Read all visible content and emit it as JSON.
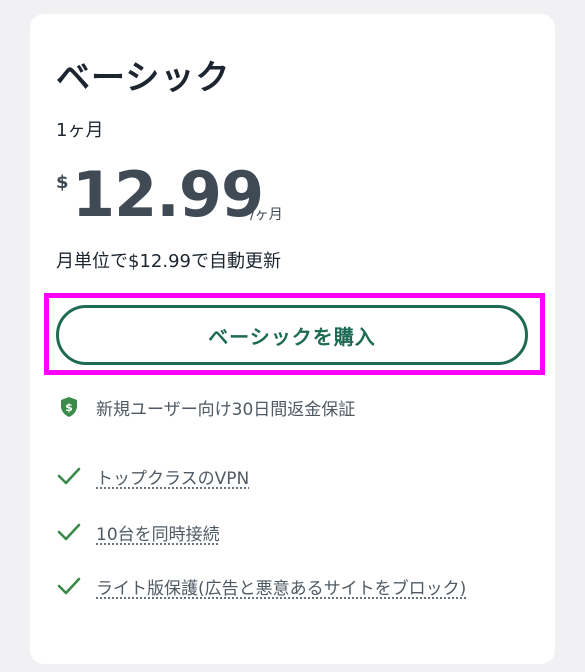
{
  "plan": {
    "title": "ベーシック",
    "period": "1ヶ月",
    "currency_symbol": "$",
    "price": "12.99",
    "price_unit": "/ヶ月",
    "renewal_note": "月単位で$12.99で自動更新"
  },
  "buy_button": {
    "label": "ベーシックを購入"
  },
  "features": [
    {
      "icon": "shield-dollar-icon",
      "text": "新規ユーザー向け30日間返金保証"
    },
    {
      "icon": "checkmark-icon",
      "text": "トップクラスのVPN"
    },
    {
      "icon": "checkmark-icon",
      "text": "10台を同時接続"
    },
    {
      "icon": "checkmark-icon",
      "text": "ライト版保護(広告と悪意あるサイトをブロック)"
    }
  ],
  "colors": {
    "accent": "#1e6b53",
    "highlight": "#ff00ff",
    "check": "#3a8a4a"
  }
}
